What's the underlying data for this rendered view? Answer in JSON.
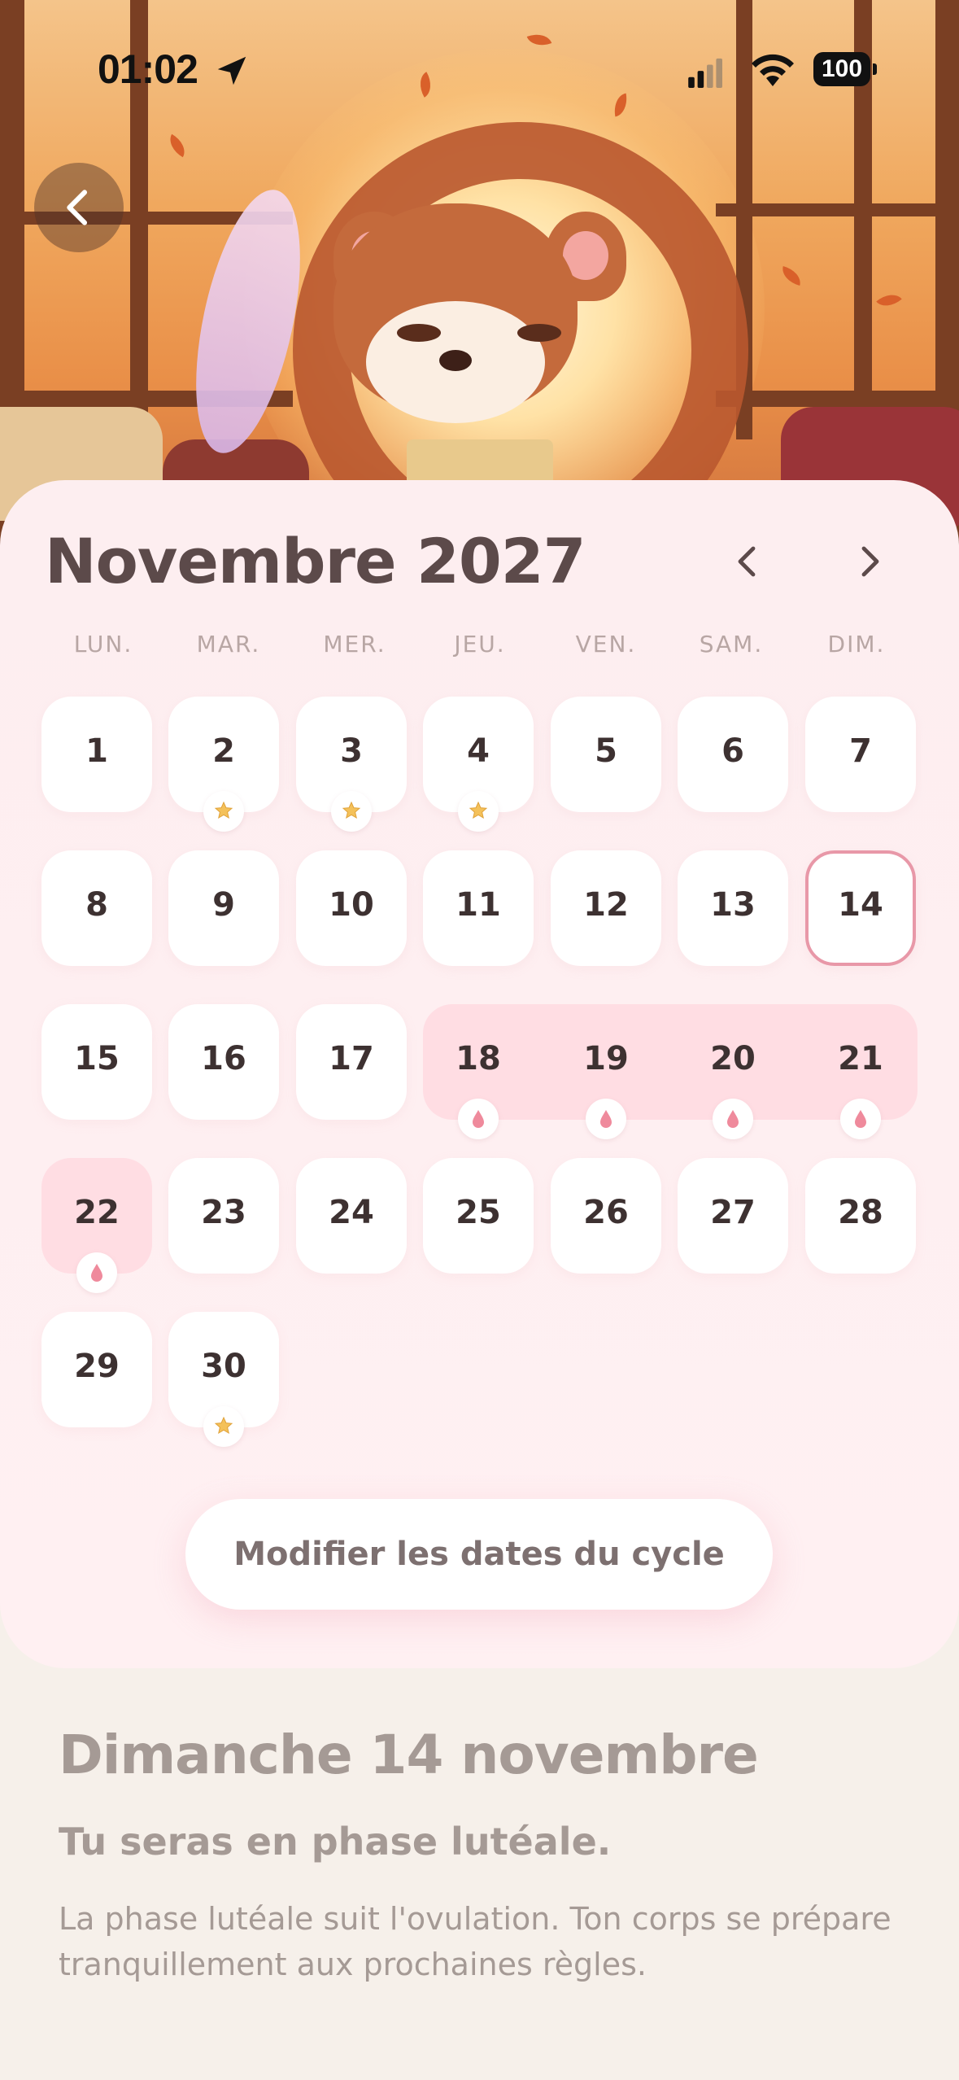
{
  "status_bar": {
    "time": "01:02",
    "battery": "100"
  },
  "calendar": {
    "month_title": "Novembre 2027",
    "weekdays": [
      "LUN.",
      "MAR.",
      "MER.",
      "JEU.",
      "VEN.",
      "SAM.",
      "DIM."
    ],
    "days": [
      "1",
      "2",
      "3",
      "4",
      "5",
      "6",
      "7",
      "8",
      "9",
      "10",
      "11",
      "12",
      "13",
      "14",
      "15",
      "16",
      "17",
      "18",
      "19",
      "20",
      "21",
      "22",
      "23",
      "24",
      "25",
      "26",
      "27",
      "28",
      "29",
      "30"
    ],
    "today": "14",
    "period_days": [
      "18",
      "19",
      "20",
      "21",
      "22"
    ],
    "star_days": [
      "2",
      "3",
      "4",
      "30"
    ]
  },
  "edit_button": {
    "label": "Modifier les dates du cycle"
  },
  "info": {
    "date_heading": "Dimanche 14 novembre",
    "phase_title": "Tu seras en phase lutéale.",
    "phase_desc": "La phase lutéale suit l'ovulation. Ton corps se prépare tranquillement aux prochaines règles."
  },
  "icons": {
    "back": "chevron-left-icon",
    "prev": "chevron-left-icon",
    "next": "chevron-right-icon",
    "period": "drop-icon",
    "star": "star-icon"
  },
  "colors": {
    "accent": "#e898a8",
    "period_bg": "#ffdde3",
    "text_dark": "#3d3131",
    "muted": "#a59a95"
  }
}
